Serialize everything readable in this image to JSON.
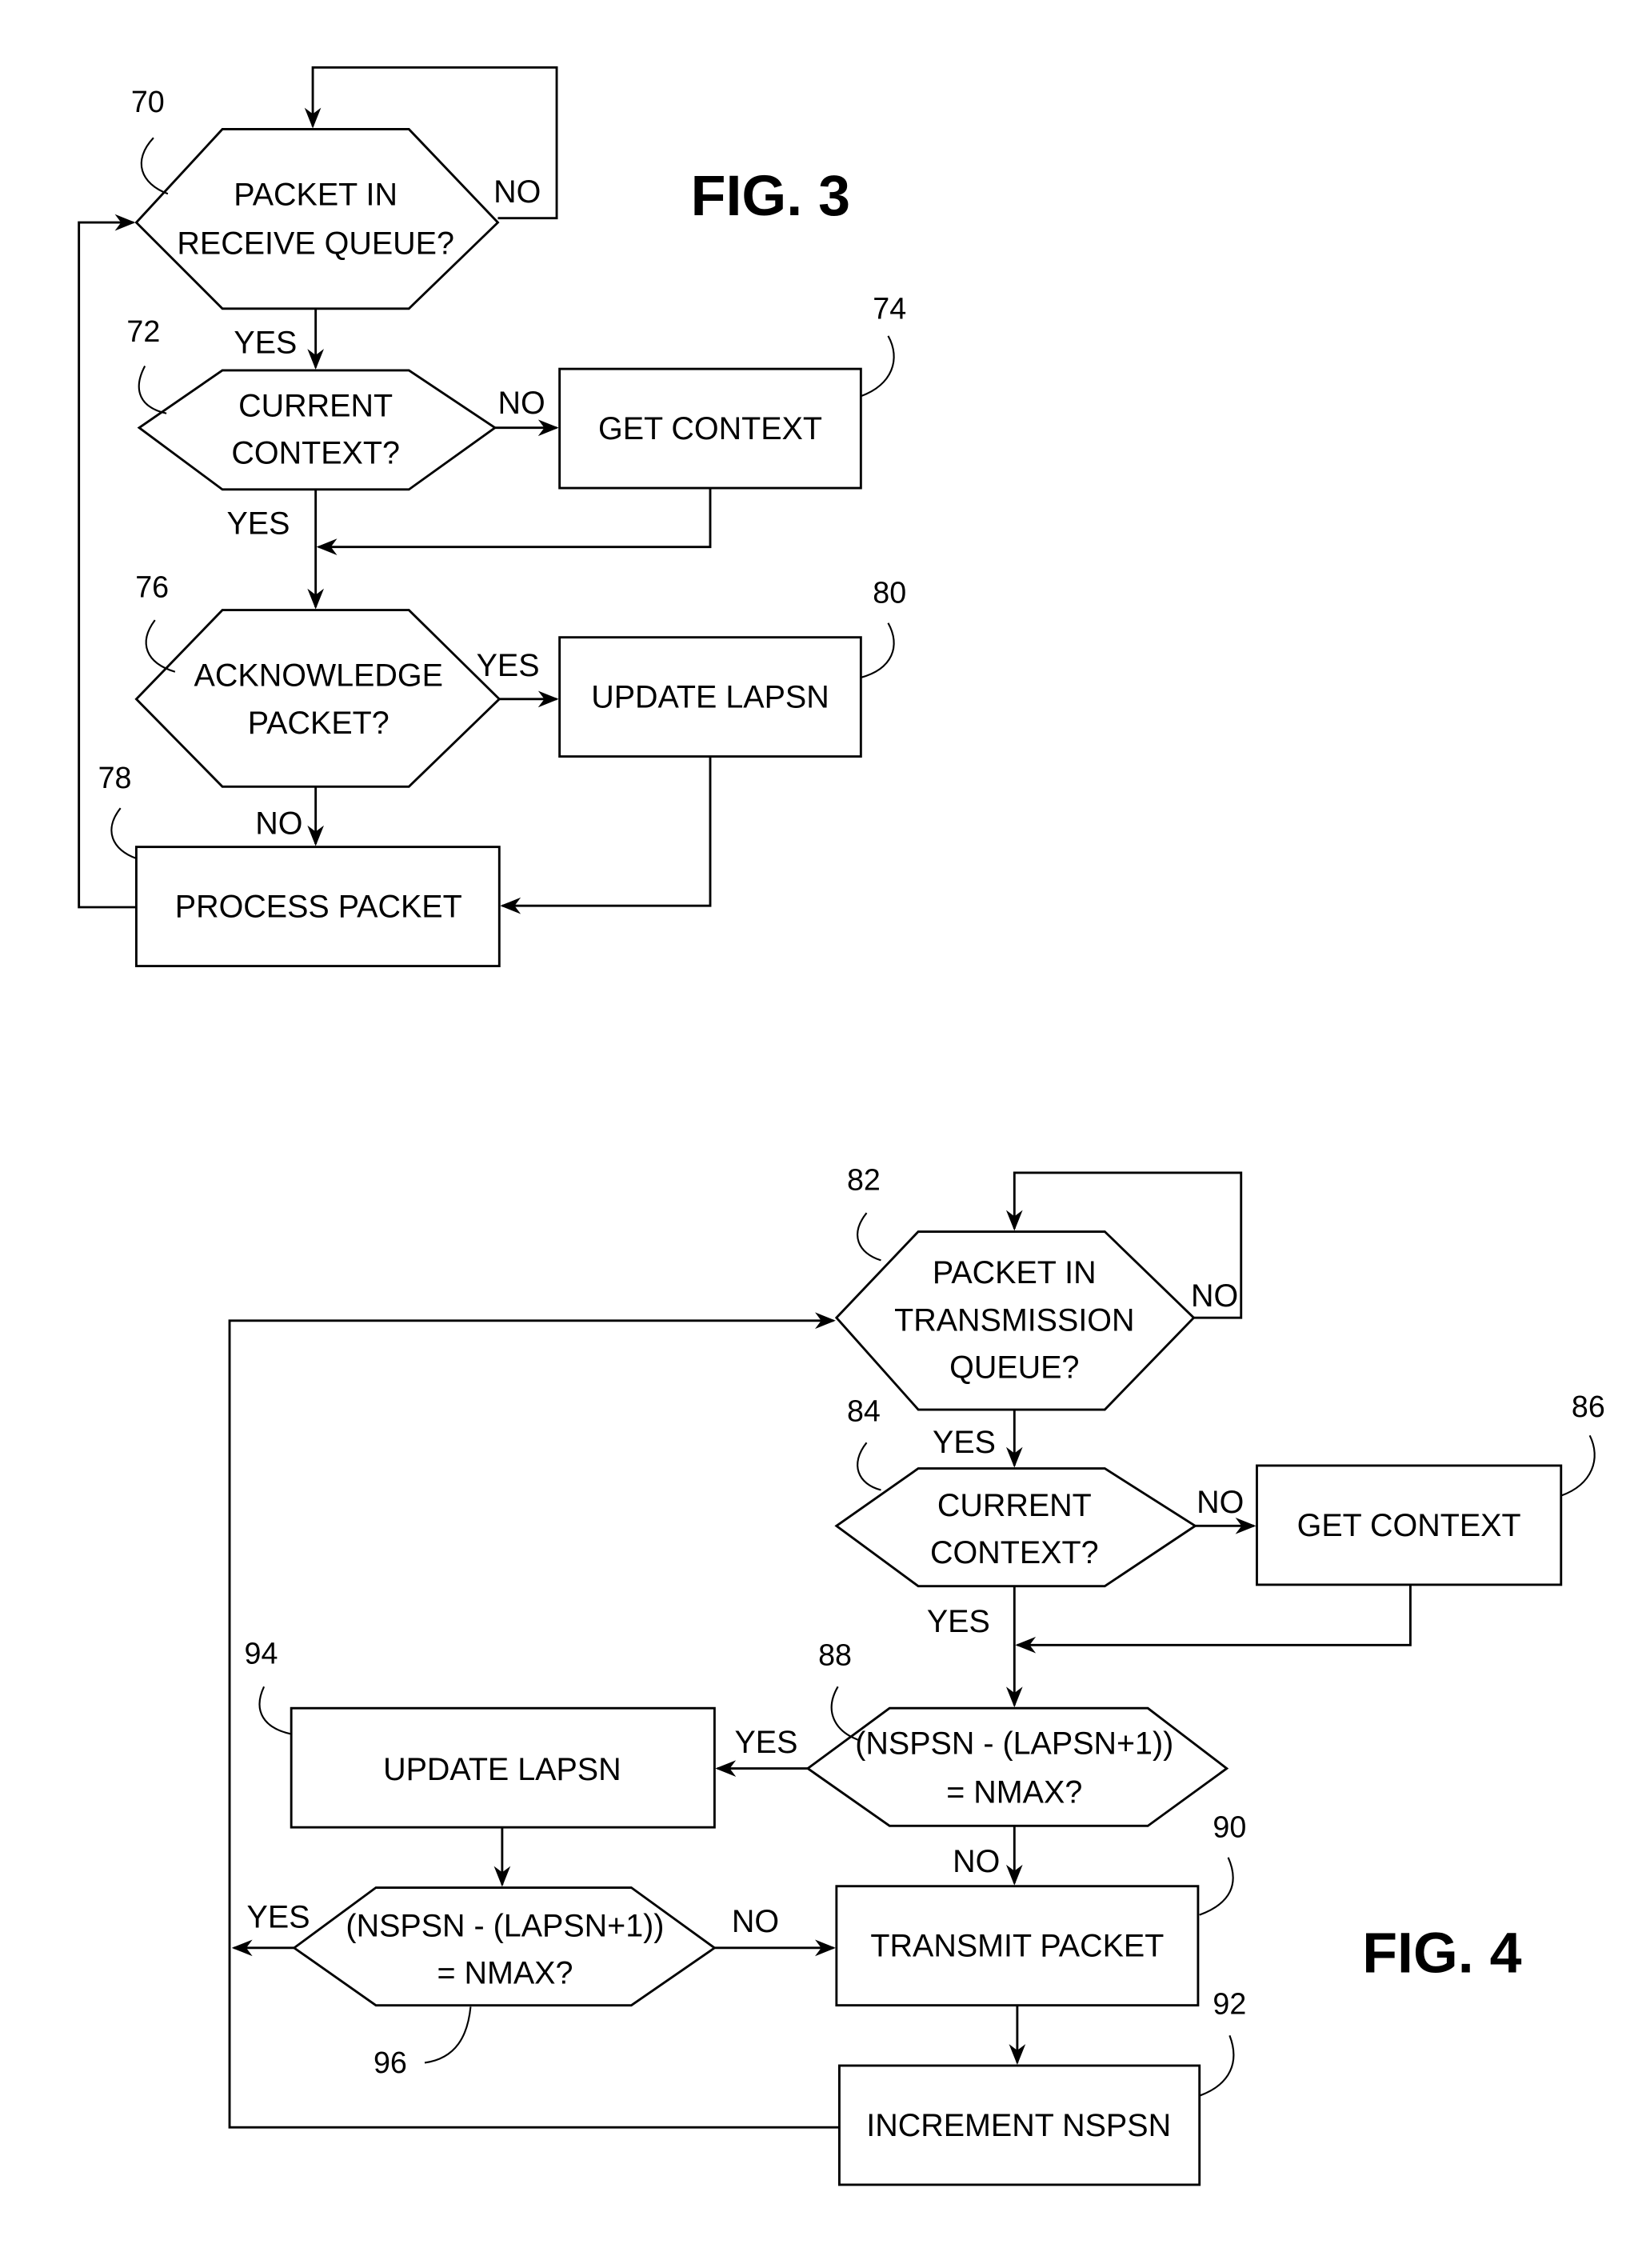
{
  "figures": [
    {
      "title": "FIG. 3",
      "nodes": [
        {
          "ref": "70",
          "type": "decision",
          "lines": [
            "PACKET IN",
            "RECEIVE QUEUE?"
          ]
        },
        {
          "ref": "72",
          "type": "decision",
          "lines": [
            "CURRENT",
            "CONTEXT?"
          ]
        },
        {
          "ref": "74",
          "type": "process",
          "lines": [
            "GET CONTEXT"
          ]
        },
        {
          "ref": "76",
          "type": "decision",
          "lines": [
            "ACKNOWLEDGE",
            "PACKET?"
          ]
        },
        {
          "ref": "80",
          "type": "process",
          "lines": [
            "UPDATE LAPSN"
          ]
        },
        {
          "ref": "78",
          "type": "process",
          "lines": [
            "PROCESS PACKET"
          ]
        }
      ],
      "edge_labels": {
        "n70_no": "NO",
        "n70_yes": "YES",
        "n72_no": "NO",
        "n72_yes": "YES",
        "n76_yes": "YES",
        "n76_no": "NO"
      }
    },
    {
      "title": "FIG. 4",
      "nodes": [
        {
          "ref": "82",
          "type": "decision",
          "lines": [
            "PACKET IN",
            "TRANSMISSION",
            "QUEUE?"
          ]
        },
        {
          "ref": "84",
          "type": "decision",
          "lines": [
            "CURRENT",
            "CONTEXT?"
          ]
        },
        {
          "ref": "86",
          "type": "process",
          "lines": [
            "GET CONTEXT"
          ]
        },
        {
          "ref": "88",
          "type": "decision",
          "lines": [
            "(NSPSN - (LAPSN+1))",
            "= NMAX?"
          ]
        },
        {
          "ref": "94",
          "type": "process",
          "lines": [
            "UPDATE LAPSN"
          ]
        },
        {
          "ref": "96",
          "type": "decision",
          "lines": [
            "(NSPSN - (LAPSN+1))",
            "= NMAX?"
          ]
        },
        {
          "ref": "90",
          "type": "process",
          "lines": [
            "TRANSMIT PACKET"
          ]
        },
        {
          "ref": "92",
          "type": "process",
          "lines": [
            "INCREMENT NSPSN"
          ]
        }
      ],
      "edge_labels": {
        "n82_no": "NO",
        "n82_yes": "YES",
        "n84_no": "NO",
        "n84_yes": "YES",
        "n88_yes": "YES",
        "n88_no": "NO",
        "n96_yes": "YES",
        "n96_no": "NO"
      }
    }
  ]
}
